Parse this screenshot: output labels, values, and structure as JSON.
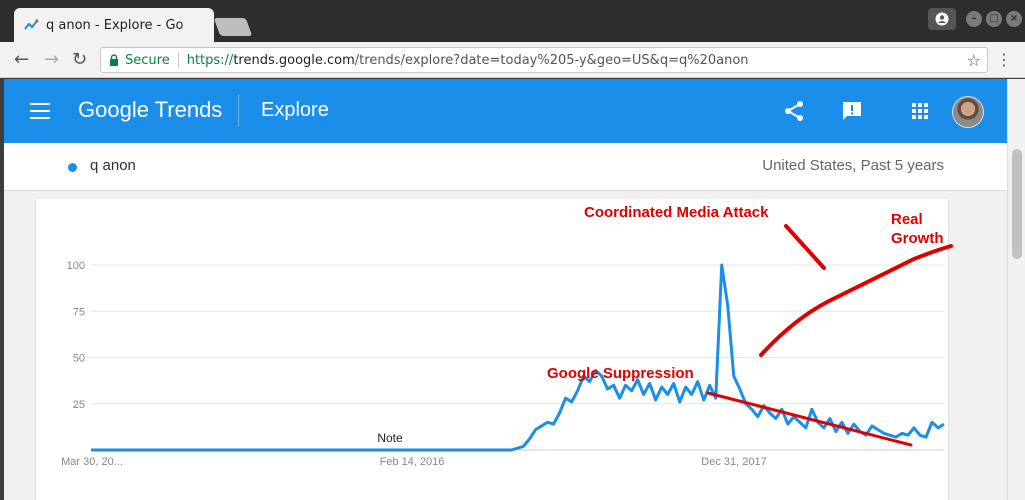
{
  "browser": {
    "tab_title": "q anon - Explore - Go",
    "security_label": "Secure",
    "url_scheme": "https://",
    "url_host": "trends.google.com",
    "url_path": "/trends/explore?date=today%205-y&geo=US&q=q%20anon"
  },
  "header": {
    "brand": "Google Trends",
    "page": "Explore"
  },
  "term": {
    "label": "q anon",
    "meta": "United States, Past 5 years",
    "color": "#1a8ee8"
  },
  "chart_data": {
    "type": "line",
    "xlabel": "",
    "ylabel": "",
    "x_ticks": [
      "Mar 30, 20...",
      "Feb 14, 2016",
      "Dec 31, 2017"
    ],
    "y_ticks": [
      100,
      75,
      50,
      25
    ],
    "ylim": [
      0,
      100
    ],
    "grid": true,
    "note": "Note",
    "series": [
      {
        "color": "#1a8ee8",
        "x": [
          0,
          50,
          100,
          150,
          200,
          210,
          213,
          216,
          219,
          222,
          225,
          228,
          231,
          234,
          237,
          240,
          243,
          246,
          249,
          252,
          255,
          258,
          261,
          264,
          267,
          270,
          273,
          276,
          279,
          282,
          285,
          288,
          291,
          294,
          297,
          300,
          303,
          306,
          309,
          312,
          315,
          318,
          321,
          324,
          327,
          330,
          333,
          336,
          339,
          342,
          345,
          348,
          351,
          354,
          357,
          360,
          363,
          366,
          369,
          372,
          375,
          378,
          381,
          384,
          387,
          390,
          393,
          396,
          399,
          402,
          405,
          408,
          411,
          414,
          417,
          420,
          423,
          426
        ],
        "values": [
          0,
          0,
          0,
          0,
          0,
          0,
          1,
          2,
          6,
          11,
          13,
          15,
          14,
          20,
          28,
          26,
          32,
          40,
          37,
          43,
          40,
          33,
          35,
          28,
          35,
          32,
          38,
          30,
          36,
          27,
          34,
          30,
          36,
          26,
          34,
          30,
          37,
          27,
          35,
          28,
          100,
          78,
          40,
          33,
          25,
          22,
          18,
          24,
          20,
          17,
          22,
          14,
          18,
          15,
          12,
          22,
          15,
          12,
          17,
          10,
          15,
          9,
          14,
          10,
          8,
          13,
          11,
          9,
          8,
          7,
          9,
          8,
          12,
          8,
          7,
          15,
          12,
          14
        ]
      }
    ]
  },
  "annotations": [
    {
      "text": "Coordinated Media Attack",
      "color": "#e00000"
    },
    {
      "text": "Real",
      "color": "#e00000"
    },
    {
      "text": "Growth",
      "color": "#e00000"
    },
    {
      "text": "Google Suppression",
      "color": "#e00000"
    }
  ]
}
